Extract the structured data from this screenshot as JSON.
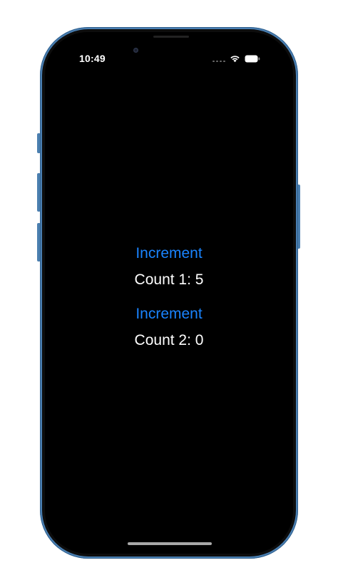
{
  "status_bar": {
    "time": "10:49",
    "icons": [
      "cellular-signal-icon",
      "wifi-icon",
      "battery-icon"
    ]
  },
  "counters": [
    {
      "button_label": "Increment",
      "count_label": "Count 1: 5"
    },
    {
      "button_label": "Increment",
      "count_label": "Count 2: 0"
    }
  ],
  "colors": {
    "accent": "#1a84ff",
    "background": "#000000",
    "frame": "#4a7fb2"
  }
}
